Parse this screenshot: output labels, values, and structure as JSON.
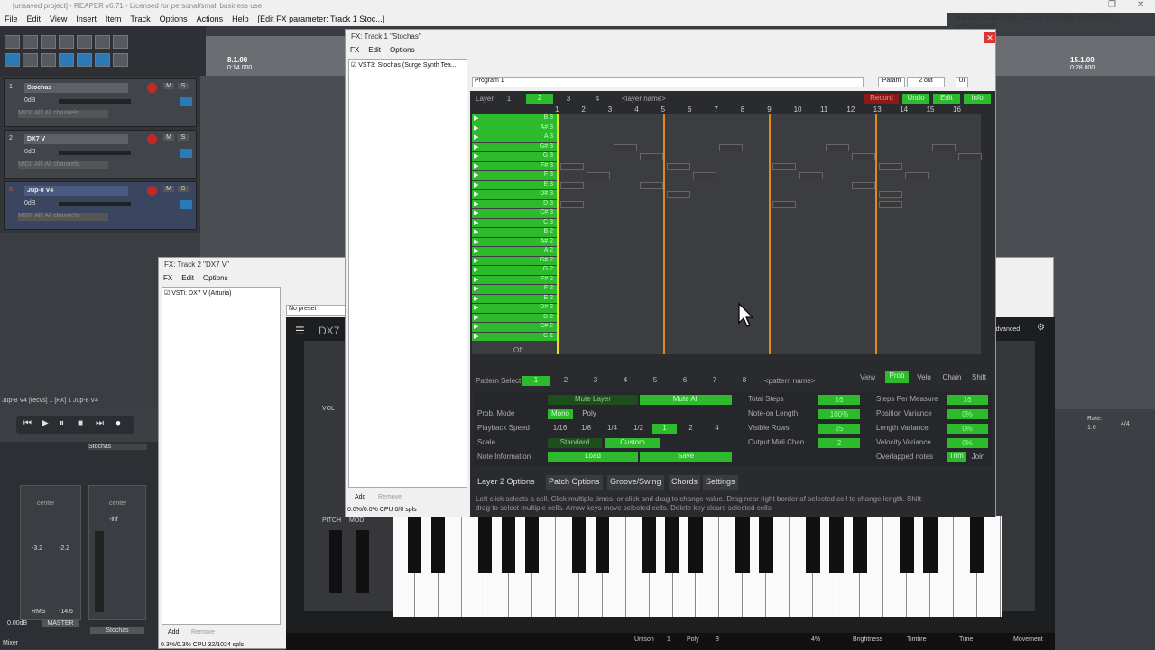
{
  "reaper": {
    "title": "[unsaved project] - REAPER v6.71 - Licensed for personal/small business use",
    "format": "[44.1kHz 24bit WAV : 2/2ch 1024spls ~0.0/213ms DirectSound]",
    "menu": [
      "File",
      "Edit",
      "View",
      "Insert",
      "Item",
      "Track",
      "Options",
      "Actions",
      "Help",
      "[Edit FX parameter: Track 1 Stoc...]"
    ]
  },
  "ruler": {
    "m1": "8.1.00",
    "t1": "0:14.000",
    "m2": "15.1.00",
    "t2": "0:28.000"
  },
  "tracks": [
    {
      "num": "1",
      "name": "Stochas",
      "vol": "0dB",
      "midi": "MIDI: All: All channels"
    },
    {
      "num": "2",
      "name": "DX7 V",
      "vol": "0dB",
      "midi": "MIDI: All: All channels"
    },
    {
      "num": "3",
      "name": "Jup-8 V4",
      "vol": "0dB",
      "midi": "MIDI: All: All channels"
    }
  ],
  "fx1": {
    "title": "FX: Track 1 \"Stochas\"",
    "menu": [
      "FX",
      "Edit",
      "Options"
    ],
    "plugin": "VST3: Stochas (Surge Synth Tea...",
    "preset": "Program 1",
    "param": "Param",
    "out": "2 out",
    "ui": "UI"
  },
  "fx2": {
    "title": "FX: Track 2 \"DX7 V\"",
    "menu": [
      "FX",
      "Edit",
      "Options"
    ],
    "plugin": "VSTi: DX7 V (Arturia)",
    "preset": "No preset",
    "add": "Add",
    "remove": "Remove",
    "cpu": "0.3%/0.3% CPU 32/1024 spls"
  },
  "fx1foot": {
    "add": "Add",
    "remove": "Remove",
    "cpu": "0.0%/0.0% CPU 0/0 spls"
  },
  "stochas": {
    "layer": "Layer",
    "layers": [
      "1",
      "2",
      "3",
      "4"
    ],
    "layer_name": "<layer name>",
    "record": "Record",
    "undo": "Undo",
    "edit": "Edit",
    "info": "Info",
    "steps": [
      "1",
      "2",
      "3",
      "4",
      "5",
      "6",
      "7",
      "8",
      "9",
      "10",
      "11",
      "12",
      "13",
      "14",
      "15",
      "16"
    ],
    "rows": [
      "B 3",
      "A# 3",
      "A 3",
      "G# 3",
      "G 3",
      "F# 3",
      "F 3",
      "E 3",
      "D# 3",
      "D 3",
      "C# 3",
      "C 3",
      "B 2",
      "A# 2",
      "A 2",
      "G# 2",
      "G 2",
      "F# 2",
      "F 2",
      "E 2",
      "D# 2",
      "D 2",
      "C# 2",
      "C 2"
    ],
    "off": "Off",
    "pattern_select": "Pattern Select",
    "patterns": [
      "1",
      "2",
      "3",
      "4",
      "5",
      "6",
      "7",
      "8"
    ],
    "pattern_name": "<pattern name>",
    "view": "View",
    "views": [
      "Prob",
      "Velo",
      "Chain",
      "Shift"
    ],
    "mute_layer": "Mute Layer",
    "mute_all": "Mute All",
    "prob_mode": "Prob. Mode",
    "mono": "Mono",
    "poly": "Poly",
    "playback_speed": "Playback Speed",
    "speeds": [
      "1/16",
      "1/8",
      "1/4",
      "1/2",
      "1",
      "2",
      "4"
    ],
    "scale": "Scale",
    "standard": "Standard",
    "custom": "Custom",
    "note_info": "Note Information",
    "load": "Load",
    "save": "Save",
    "total_steps": "Total Steps",
    "total_steps_v": "16",
    "note_len": "Note-on Length",
    "note_len_v": "100%",
    "vis_rows": "Visible Rows",
    "vis_rows_v": "25",
    "midi_chan": "Output Midi Chan",
    "midi_chan_v": "2",
    "spm": "Steps Per Measure",
    "spm_v": "16",
    "pos_var": "Position Variance",
    "pos_var_v": "0%",
    "len_var": "Length Variance",
    "len_var_v": "0%",
    "vel_var": "Velocity Variance",
    "vel_var_v": "0%",
    "overlap": "Overlapped notes",
    "trim": "Trim",
    "join": "Join",
    "tabs": [
      "Layer 2 Options",
      "Patch Options",
      "Groove/Swing",
      "Chords",
      "Settings"
    ],
    "help": "Left click selects a cell. Click multiple times, or click and drag to change value. Drag near right border of selected cell to change length. Shift-drag to select multiple cells. Arrow keys move selected cells. Delete key clears selected cells"
  },
  "dx7": {
    "name": "DX7",
    "advanced": "Advanced",
    "vol": "VOL",
    "pitch": "PITCH",
    "mod": "MOD",
    "unison": "Unison",
    "unison_v": "1",
    "poly": "Poly",
    "poly_v": "8",
    "pct": "4%",
    "brightness": "Brightness",
    "timbre": "Timbre",
    "time": "Time",
    "movement": "Movement"
  },
  "mixer": {
    "label": "Mixer",
    "master": "MASTER",
    "stochas": "Stochas",
    "center": "center",
    "rms": "RMS",
    "rms_v": "-14.6",
    "db1": "-3.2",
    "db2": "-2.2",
    "db3": "0.00dB",
    "inf": "-inf",
    "track_info": "Jup-8 V4 [recvs] 1 [FX] 1 Jup-8 V4"
  },
  "transport": {
    "rate": "Rate:",
    "rate_v": "1.0",
    "sig": "4/4"
  },
  "colors": {
    "green": "#2dba2d",
    "orange": "#e08a1e",
    "yellow": "#e8e020"
  }
}
